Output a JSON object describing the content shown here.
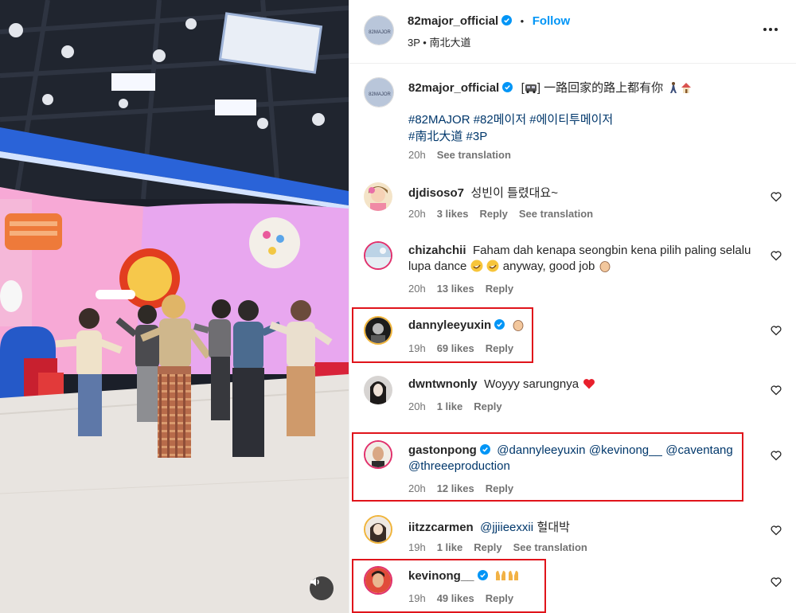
{
  "post": {
    "author": "82major_official",
    "separator": "•",
    "follow_label": "Follow",
    "location": "3P • 南北大道",
    "avatar_text": "82MAJOR",
    "caption_prefix": "[",
    "caption_suffix": "] 一路回家的路上都有你",
    "hashtags_line1": "#82MAJOR #82메이저 #에이티투메이저",
    "hashtags_line2": "#南北大道 #3P",
    "time": "20h",
    "see_translation": "See translation"
  },
  "comments": [
    {
      "user": "djdisoso7",
      "text": "성빈이 틀렸대요~",
      "time": "20h",
      "likes": "3 likes",
      "reply": "Reply",
      "translate": "See translation"
    },
    {
      "user": "chizahchii",
      "text_line1": "Faham dah kenapa seongbin kena pilih paling selalu",
      "text_line2a": "lupa dance",
      "text_line2b": "anyway, good job",
      "time": "20h",
      "likes": "13 likes",
      "reply": "Reply"
    },
    {
      "user": "dannyleeyuxin",
      "time": "19h",
      "likes": "69 likes",
      "reply": "Reply"
    },
    {
      "user": "dwntwnonly",
      "text": "Woyyy sarungnya",
      "time": "20h",
      "likes": "1 like",
      "reply": "Reply"
    },
    {
      "user": "gastonpong",
      "mention1": "@dannyleeyuxin",
      "mention2": "@kevinong__",
      "mention3": "@caventang",
      "mention4": "@threeeproduction",
      "time": "20h",
      "likes": "12 likes",
      "reply": "Reply"
    },
    {
      "user": "iitzzcarmen",
      "mention": "@jjiieexxii",
      "text": "헐대박",
      "time": "19h",
      "likes": "1 like",
      "reply": "Reply",
      "translate": "See translation"
    },
    {
      "user": "kevinong__",
      "time": "19h",
      "likes": "49 likes",
      "reply": "Reply"
    }
  ],
  "colors": {
    "accent": "#0095f6",
    "verified": "#0095f6",
    "highlight": "#e0141b",
    "link": "#00376b"
  },
  "icons": [
    "more-icon",
    "verified-icon",
    "heart-icon",
    "sound-icon",
    "emoji-icon"
  ]
}
